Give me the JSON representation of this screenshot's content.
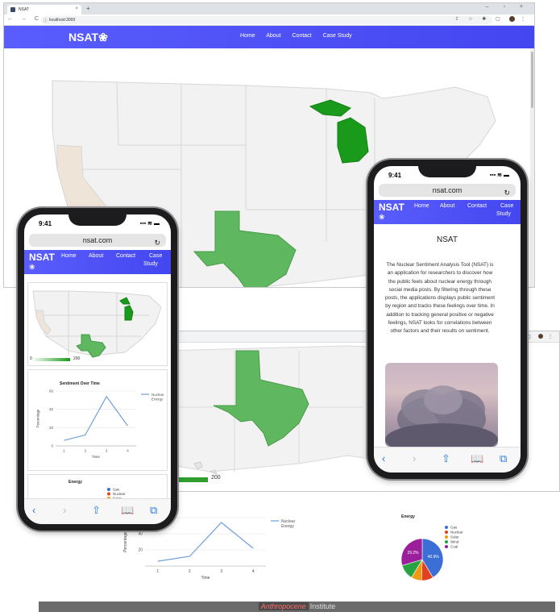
{
  "desktop": {
    "tab_title": "NSAT",
    "tab_close": "×",
    "new_tab": "+",
    "window_controls": "– ▫ ×",
    "url": "localhost:3000",
    "logo": "NSAT",
    "logo_glyph": "❀",
    "nav": [
      "Home",
      "About",
      "Contact",
      "Case Study"
    ],
    "state_colors": {
      "highlight_strong": "#1a9a1a",
      "highlight_mid": "#5fb85f",
      "base": "#f2f2f2",
      "tan": "#efe4d8",
      "border": "#d9d9d9"
    },
    "map_legend_value": "200"
  },
  "bottom_strip": {
    "line_title_fragment": "ime",
    "footer_brand": "Anthropocene",
    "footer_suffix": "Institute"
  },
  "phone_left": {
    "time": "9:41",
    "signal": "▪▪▪ ≋ ▬",
    "url": "nsat.com",
    "reload": "↻",
    "logo": "NSAT",
    "logo_glyph": "❀",
    "nav": [
      "Home",
      "About",
      "Contact",
      "Case",
      "Study"
    ],
    "map_legend_min": "0",
    "map_legend_max": "200",
    "safari": [
      "‹",
      "›",
      "⇧",
      "📖",
      "⧉"
    ]
  },
  "phone_right": {
    "time": "9:41",
    "signal": "▪▪▪ ≋ ▬",
    "url": "nsat.com",
    "reload": "↻",
    "logo": "NSAT",
    "logo_glyph": "❀",
    "nav": [
      "Home",
      "About",
      "Contact",
      "Case",
      "Study"
    ],
    "about_title": "NSAT",
    "about_text": "The Nuclear Sentiment Analysis Tool (NSAT) is an application for researchers to discover how the public feels about nuclear energy through social media posts. By filtering through these posts, the applications displays public sentiment by region and tracks these feelings over time. In addition to tracking general positive or negative feelings, NSAT looks for correlations between other factors and their results on sentiment.",
    "safari": [
      "‹",
      "›",
      "⇧",
      "📖",
      "⧉"
    ]
  },
  "chart_data": [
    {
      "type": "line",
      "title": "Sentiment Over Time",
      "xlabel": "Time",
      "ylabel": "Percentage",
      "x": [
        1,
        2,
        3,
        4
      ],
      "series": [
        {
          "name": "Nuclear Energy",
          "values": [
            6,
            12,
            54,
            22
          ],
          "color": "#6fa0dc"
        }
      ],
      "ylim": [
        0,
        60
      ],
      "yticks": [
        0,
        20,
        40,
        60
      ],
      "legend": "right"
    },
    {
      "type": "pie",
      "title": "Energy",
      "labels": [
        "Gas",
        "Nuclear",
        "Solar",
        "Wind",
        "Coal"
      ],
      "values": [
        40.9,
        9.0,
        8.0,
        11.7,
        29.2
      ],
      "slice_labels": [
        "40.9%",
        "",
        "",
        "",
        "29.2%"
      ],
      "colors": [
        "#3b6fd6",
        "#e0421f",
        "#f29a0f",
        "#27a342",
        "#9b1f9b"
      ],
      "legend": "right"
    }
  ]
}
